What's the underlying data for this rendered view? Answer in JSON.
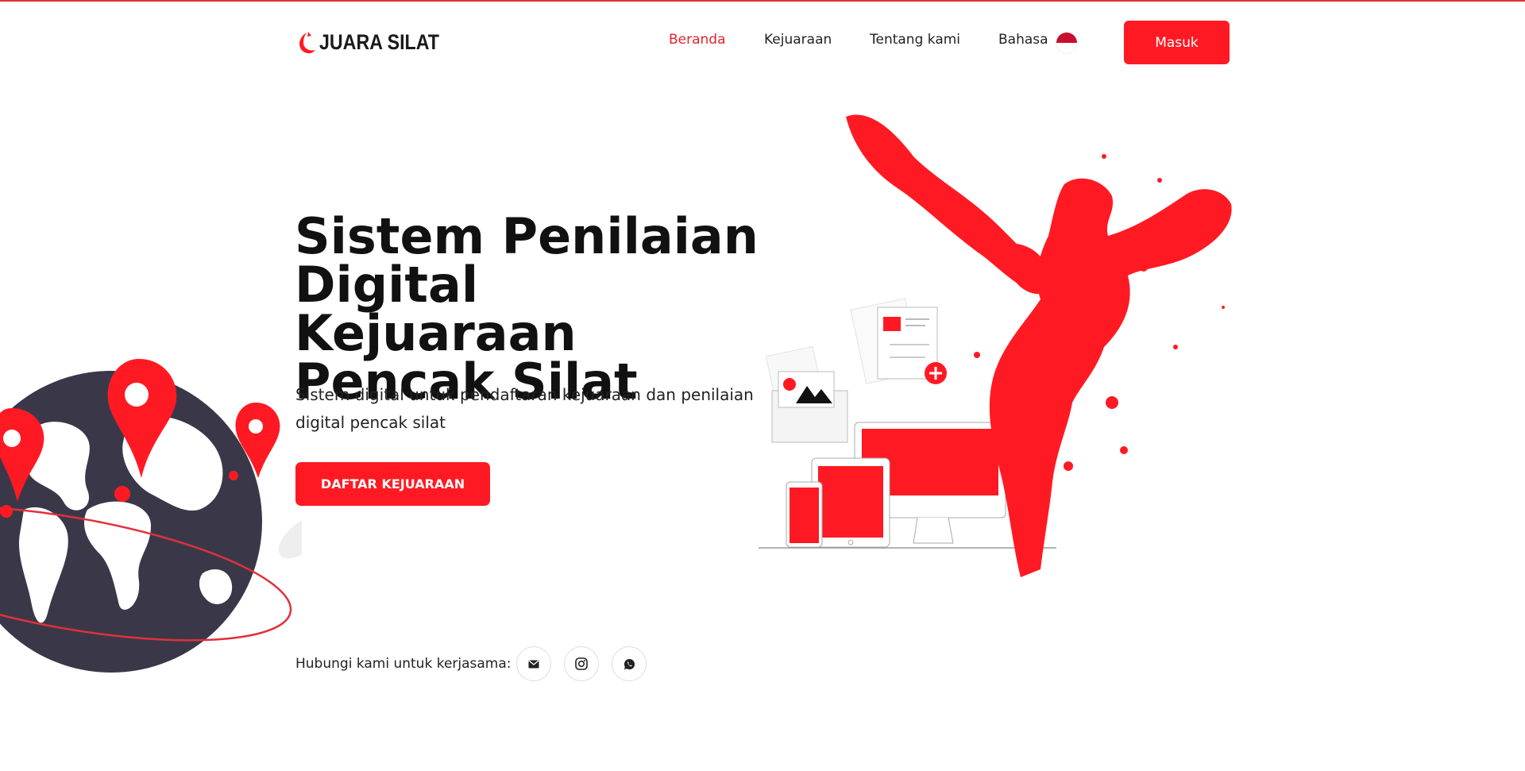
{
  "header": {
    "logo_text": "JUARA SILAT",
    "nav": [
      {
        "label": "Beranda",
        "active": true
      },
      {
        "label": "Kejuaraan",
        "active": false
      },
      {
        "label": "Tentang kami",
        "active": false
      },
      {
        "label": "Bahasa",
        "active": false
      }
    ],
    "language_flag": "indonesia-flag-icon",
    "login_label": "Masuk"
  },
  "hero": {
    "title": "Sistem Penilaian Digital Kejuaraan Pencak Silat",
    "description": "Sistem digital untuk pendaftaran kejuaraan dan penilaian digital pencak silat",
    "cta_label": "DAFTAR KEJUARAAN"
  },
  "contact": {
    "label": "Hubungi kami untuk kerjasama:",
    "icons": [
      "mail-icon",
      "instagram-icon",
      "whatsapp-icon"
    ]
  },
  "colors": {
    "accent": "#ff1a23",
    "active_nav": "#e8212b",
    "globe": "#3a3848",
    "text": "#111111"
  }
}
